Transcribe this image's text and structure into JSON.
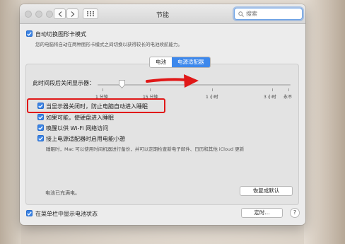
{
  "window": {
    "title": "节能"
  },
  "search": {
    "placeholder": "搜索"
  },
  "auto_switch": {
    "label": "自动切换图形卡模式",
    "description": "您的电脑将自动在两种图形卡模式之间切换以获得较长的电池续航能力。",
    "checked": true
  },
  "tabs": [
    {
      "label": "电池",
      "active": false
    },
    {
      "label": "电源适配器",
      "active": true
    }
  ],
  "display_sleep": {
    "label": "此时间段后关闭显示器：",
    "ticks": [
      "1 分钟",
      "15 分钟",
      "1 小时",
      "3 小时",
      "永不"
    ],
    "value": "4 分钟"
  },
  "options": [
    {
      "label": "当显示器关闭时，防止电脑自动进入睡眠",
      "checked": true
    },
    {
      "label": "如果可能，使硬盘进入睡眠",
      "checked": true
    },
    {
      "label": "唤醒以供 Wi-Fi 网络访问",
      "checked": true
    },
    {
      "label": "接上电源适配器时启用电能小憩",
      "checked": true,
      "description": "睡眠时，Mac 可以使用时间机器进行备份，并可以定期检查新电子邮件、日历和其他 iCloud 更新"
    }
  ],
  "status": {
    "text": "电池已充满电。"
  },
  "restore_defaults": {
    "label": "恢复成默认"
  },
  "menubar_battery": {
    "label": "在菜单栏中显示电池状态",
    "checked": true
  },
  "schedule": {
    "label": "定时..."
  },
  "help": {
    "label": "?"
  },
  "colors": {
    "accent": "#3d88ec",
    "annotation": "#e01818"
  }
}
